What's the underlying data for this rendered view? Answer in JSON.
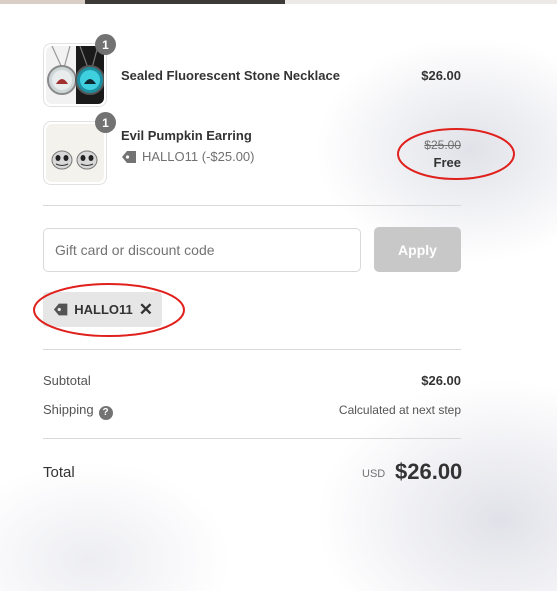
{
  "items": [
    {
      "name": "Sealed Fluorescent Stone Necklace",
      "quantity": "1",
      "price": "$26.00"
    },
    {
      "name": "Evil Pumpkin Earring",
      "quantity": "1",
      "discount_label": "HALLO11 (-$25.00)",
      "original_price": "$25.00",
      "price": "Free"
    }
  ],
  "discount": {
    "placeholder": "Gift card or discount code",
    "apply_label": "Apply",
    "applied_code": "HALLO11",
    "remove_symbol": "✕"
  },
  "summary": {
    "subtotal_label": "Subtotal",
    "subtotal_value": "$26.00",
    "shipping_label": "Shipping",
    "shipping_help": "?",
    "shipping_value": "Calculated at next step",
    "total_label": "Total",
    "currency": "USD",
    "total_value": "$26.00"
  },
  "colors": {
    "annotation": "#e0201c",
    "apply_disabled": "#c8c8c8",
    "quantity_badge": "#727272"
  }
}
